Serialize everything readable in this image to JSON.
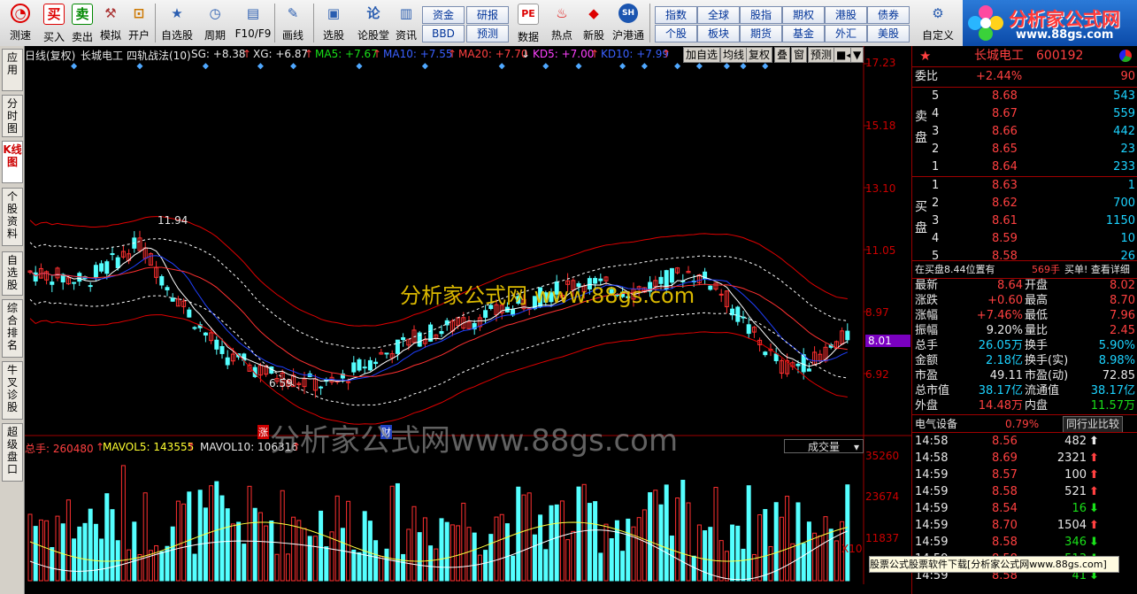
{
  "toolbar": {
    "buttons": [
      "测速",
      "买入",
      "卖出",
      "模拟",
      "开户",
      "自选股",
      "周期",
      "F10/F9",
      "画线",
      "选股",
      "论股堂",
      "资讯",
      "数据",
      "热点",
      "新股",
      "沪港通",
      "自定义"
    ],
    "grid": [
      "资金",
      "研报",
      "BBD",
      "预测",
      "指数",
      "全球",
      "股指",
      "期权",
      "港股",
      "债券",
      "个股",
      "板块",
      "期货",
      "基金",
      "外汇",
      "美股"
    ]
  },
  "brand": {
    "title": "分析家公式网",
    "url": "www.88gs.com"
  },
  "left_tabs": [
    "应用",
    "分时图",
    "K线图",
    "个股资料",
    "自选股",
    "综合排名",
    "牛叉诊股",
    "超级盘口"
  ],
  "chart": {
    "header": {
      "period": "日线(复权)",
      "stock": "长城电工",
      "indicator": "四轨战法(10)",
      "sg": "SG: +8.38",
      "xg": "XG: +6.87",
      "ma5": "MA5: +7.67",
      "ma10": "MA10: +7.55",
      "ma20": "MA20: +7.70",
      "kd5": "KD5: +7.00",
      "kd10": "KD10: +7.99"
    },
    "chips": [
      "加自选",
      "均线",
      "复权",
      "叠",
      "窗",
      "预测"
    ],
    "price_axis": [
      "17.23",
      "15.18",
      "13.10",
      "11.05",
      "8.97",
      "8.01",
      "6.92"
    ],
    "annotations": {
      "high": "11.94",
      "low": "6.59",
      "zhang": "涨",
      "cai": "财"
    },
    "volume_header": {
      "total": "总手: 260480",
      "mavol5": "MAVOL5: 143555",
      "mavol10": "MAVOL10: 106316",
      "tab": "成交量"
    },
    "volume_axis": [
      "35260",
      "23674",
      "11837",
      "X10"
    ],
    "watermark_big": "分析家公式网www.88gs.com",
    "watermark_small": "分析家公式网 www.88gs.com",
    "colors": {
      "up": "#ff3030",
      "down": "#54ffff",
      "ma5": "#ffffff",
      "ma10": "#ffff00",
      "ma20": "#ff00ff",
      "band": "#e00000"
    }
  },
  "quote": {
    "title": "长城电工",
    "code": "600192",
    "weibi_label": "委比",
    "weibi": "+2.44%",
    "weibi_val": "90",
    "sell_label": "卖盘",
    "buy_label": "买盘",
    "sell": [
      {
        "lvl": "5",
        "price": "8.68",
        "vol": "543"
      },
      {
        "lvl": "4",
        "price": "8.67",
        "vol": "559"
      },
      {
        "lvl": "3",
        "price": "8.66",
        "vol": "442"
      },
      {
        "lvl": "2",
        "price": "8.65",
        "vol": "23"
      },
      {
        "lvl": "1",
        "price": "8.64",
        "vol": "233"
      }
    ],
    "buy": [
      {
        "lvl": "1",
        "price": "8.63",
        "vol": "1"
      },
      {
        "lvl": "2",
        "price": "8.62",
        "vol": "700"
      },
      {
        "lvl": "3",
        "price": "8.61",
        "vol": "1150"
      },
      {
        "lvl": "4",
        "price": "8.59",
        "vol": "10"
      },
      {
        "lvl": "5",
        "price": "8.58",
        "vol": "26"
      }
    ],
    "position_text": "在买盘8.44位置有",
    "position_vol": "569手",
    "position_link": "买单! 查看详细",
    "stats": [
      [
        "最新",
        "8.64",
        "开盘",
        "8.02"
      ],
      [
        "涨跌",
        "+0.60",
        "最高",
        "8.70"
      ],
      [
        "涨幅",
        "+7.46%",
        "最低",
        "7.96"
      ],
      [
        "振幅",
        "9.20%",
        "量比",
        "2.45"
      ],
      [
        "总手",
        "26.05万",
        "换手",
        "5.90%"
      ],
      [
        "金额",
        "2.18亿",
        "换手(实)",
        "8.98%"
      ],
      [
        "市盈",
        "49.11",
        "市盈(动)",
        "72.85"
      ],
      [
        "总市值",
        "38.17亿",
        "流通值",
        "38.17亿"
      ],
      [
        "外盘",
        "14.48万",
        "内盘",
        "11.57万"
      ]
    ],
    "industry": "电气设备",
    "industry_chg": "0.79%",
    "industry_link": "同行业比较",
    "ticks": [
      {
        "t": "14:58",
        "p": "8.56",
        "v": "482",
        "d": "up"
      },
      {
        "t": "14:58",
        "p": "8.69",
        "v": "2321",
        "d": "up"
      },
      {
        "t": "14:59",
        "p": "8.57",
        "v": "100",
        "d": "up"
      },
      {
        "t": "14:59",
        "p": "8.58",
        "v": "521",
        "d": "up"
      },
      {
        "t": "14:59",
        "p": "8.54",
        "v": "16",
        "d": "down"
      },
      {
        "t": "14:59",
        "p": "8.70",
        "v": "1504",
        "d": "up"
      },
      {
        "t": "14:59",
        "p": "8.58",
        "v": "346",
        "d": "down"
      },
      {
        "t": "14:59",
        "p": "8.58",
        "v": "513",
        "d": "down"
      },
      {
        "t": "14:59",
        "p": "8.58",
        "v": "41",
        "d": "down"
      }
    ]
  },
  "statusbar": "股票公式股票软件下载[分析家公式网www.88gs.com]"
}
